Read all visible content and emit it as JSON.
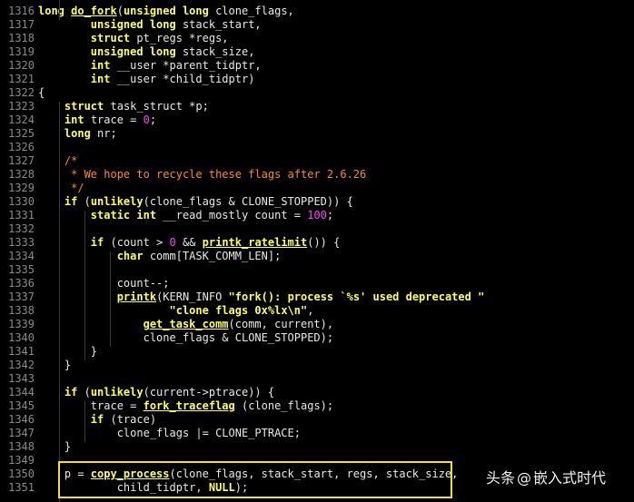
{
  "colors": {
    "background": "#000000",
    "keyword": "#ffff54",
    "comment": "#ff8c1a",
    "number": "#ff40ff",
    "line_number": "#8a8a8a",
    "highlight_box": "#f2e21c"
  },
  "watermark": {
    "brand": "头条",
    "at": "@",
    "account": "嵌入式时代"
  },
  "lines": [
    {
      "n": "1316",
      "t": [
        [
          "kw",
          "long "
        ],
        [
          "fn",
          "do_fork"
        ],
        [
          "plain",
          "("
        ],
        [
          "kw",
          "unsigned long"
        ],
        [
          "plain",
          " clone_flags,"
        ]
      ]
    },
    {
      "n": "1317",
      "t": [
        [
          "plain",
          "        "
        ],
        [
          "kw",
          "unsigned long"
        ],
        [
          "plain",
          " stack_start,"
        ]
      ]
    },
    {
      "n": "1318",
      "t": [
        [
          "plain",
          "        "
        ],
        [
          "kw",
          "struct"
        ],
        [
          "plain",
          " pt_regs *regs,"
        ]
      ]
    },
    {
      "n": "1319",
      "t": [
        [
          "plain",
          "        "
        ],
        [
          "kw",
          "unsigned long"
        ],
        [
          "plain",
          " stack_size,"
        ]
      ]
    },
    {
      "n": "1320",
      "t": [
        [
          "plain",
          "        "
        ],
        [
          "kw",
          "int"
        ],
        [
          "plain",
          " __user *parent_tidptr,"
        ]
      ]
    },
    {
      "n": "1321",
      "t": [
        [
          "plain",
          "        "
        ],
        [
          "kw",
          "int"
        ],
        [
          "plain",
          " __user *child_tidptr)"
        ]
      ]
    },
    {
      "n": "1322",
      "t": [
        [
          "plain",
          "{"
        ]
      ]
    },
    {
      "n": "1323",
      "t": [
        [
          "plain",
          "    "
        ],
        [
          "kw",
          "struct"
        ],
        [
          "plain",
          " task_struct *p;"
        ]
      ]
    },
    {
      "n": "1324",
      "t": [
        [
          "plain",
          "    "
        ],
        [
          "kw",
          "int"
        ],
        [
          "plain",
          " trace = "
        ],
        [
          "num",
          "0"
        ],
        [
          "plain",
          ";"
        ]
      ]
    },
    {
      "n": "1325",
      "t": [
        [
          "plain",
          "    "
        ],
        [
          "kw",
          "long"
        ],
        [
          "plain",
          " nr;"
        ]
      ]
    },
    {
      "n": "1326",
      "t": []
    },
    {
      "n": "1327",
      "t": [
        [
          "plain",
          "    "
        ],
        [
          "cm",
          "/*"
        ]
      ]
    },
    {
      "n": "1328",
      "t": [
        [
          "plain",
          "    "
        ],
        [
          "cm",
          " * We hope to recycle these flags after 2.6.26"
        ]
      ]
    },
    {
      "n": "1329",
      "t": [
        [
          "plain",
          "    "
        ],
        [
          "cm",
          " */"
        ]
      ]
    },
    {
      "n": "1330",
      "t": [
        [
          "plain",
          "    "
        ],
        [
          "kw",
          "if"
        ],
        [
          "plain",
          " ("
        ],
        [
          "kw",
          "unlikely"
        ],
        [
          "plain",
          "(clone_flags & CLONE_STOPPED)) {"
        ]
      ]
    },
    {
      "n": "1331",
      "t": [
        [
          "plain",
          "        "
        ],
        [
          "kw",
          "static int"
        ],
        [
          "plain",
          " __read_mostly count = "
        ],
        [
          "num",
          "100"
        ],
        [
          "plain",
          ";"
        ]
      ]
    },
    {
      "n": "1332",
      "t": []
    },
    {
      "n": "1333",
      "t": [
        [
          "plain",
          "        "
        ],
        [
          "kw",
          "if"
        ],
        [
          "plain",
          " (count > "
        ],
        [
          "num",
          "0"
        ],
        [
          "plain",
          " && "
        ],
        [
          "fn",
          "printk_ratelimit"
        ],
        [
          "plain",
          "()) {"
        ]
      ]
    },
    {
      "n": "1334",
      "t": [
        [
          "plain",
          "            "
        ],
        [
          "kw",
          "char"
        ],
        [
          "plain",
          " comm[TASK_COMM_LEN];"
        ]
      ]
    },
    {
      "n": "1335",
      "t": []
    },
    {
      "n": "1336",
      "t": [
        [
          "plain",
          "            count--;"
        ]
      ]
    },
    {
      "n": "1337",
      "t": [
        [
          "plain",
          "            "
        ],
        [
          "fn",
          "printk"
        ],
        [
          "plain",
          "(KERN_INFO "
        ],
        [
          "str",
          "\"fork(): process `%s' used deprecated \""
        ]
      ]
    },
    {
      "n": "1338",
      "t": [
        [
          "plain",
          "                    "
        ],
        [
          "str",
          "\"clone flags 0x%lx\\n\""
        ],
        [
          "plain",
          ","
        ]
      ]
    },
    {
      "n": "1339",
      "t": [
        [
          "plain",
          "                "
        ],
        [
          "fn",
          "get_task_comm"
        ],
        [
          "plain",
          "(comm, current),"
        ]
      ]
    },
    {
      "n": "1340",
      "t": [
        [
          "plain",
          "                clone_flags & CLONE_STOPPED);"
        ]
      ]
    },
    {
      "n": "1341",
      "t": [
        [
          "plain",
          "        }"
        ]
      ]
    },
    {
      "n": "1342",
      "t": [
        [
          "plain",
          "    }"
        ]
      ]
    },
    {
      "n": "1343",
      "t": []
    },
    {
      "n": "1344",
      "t": [
        [
          "plain",
          "    "
        ],
        [
          "kw",
          "if"
        ],
        [
          "plain",
          " ("
        ],
        [
          "kw",
          "unlikely"
        ],
        [
          "plain",
          "(current->ptrace)) {"
        ]
      ]
    },
    {
      "n": "1345",
      "t": [
        [
          "plain",
          "        trace = "
        ],
        [
          "fn",
          "fork_traceflag"
        ],
        [
          "plain",
          " (clone_flags);"
        ]
      ]
    },
    {
      "n": "1346",
      "t": [
        [
          "plain",
          "        "
        ],
        [
          "kw",
          "if"
        ],
        [
          "plain",
          " (trace)"
        ]
      ]
    },
    {
      "n": "1347",
      "t": [
        [
          "plain",
          "            clone_flags |= CLONE_PTRACE;"
        ]
      ]
    },
    {
      "n": "1348",
      "t": [
        [
          "plain",
          "    }"
        ]
      ]
    },
    {
      "n": "1349",
      "t": []
    },
    {
      "n": "1350",
      "t": [
        [
          "plain",
          "    p = "
        ],
        [
          "fn",
          "copy_process"
        ],
        [
          "plain",
          "(clone_flags, stack_start, regs, stack_size,"
        ]
      ]
    },
    {
      "n": "1351",
      "t": [
        [
          "plain",
          "            child_tidptr, "
        ],
        [
          "kw",
          "NULL"
        ],
        [
          "plain",
          ");"
        ]
      ]
    }
  ]
}
